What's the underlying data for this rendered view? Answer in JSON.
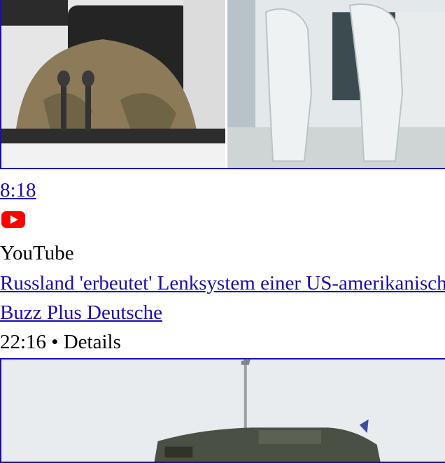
{
  "video": {
    "duration": "8:18",
    "source_icon": "youtube-icon",
    "source_name": "YouTube",
    "title": "Russland 'erbeutet' Lenksystem einer US-amerikanischen",
    "channel": "Buzz Plus Deutsche",
    "meta": "22:16 • Details"
  },
  "colors": {
    "link": "#1a0dab",
    "youtube_red": "#ff0000"
  }
}
